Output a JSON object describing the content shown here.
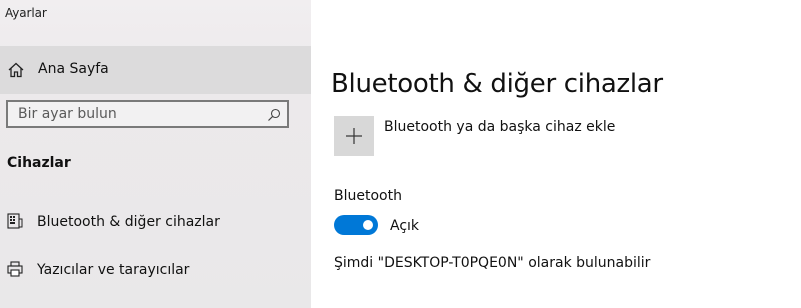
{
  "window": {
    "title": "Ayarlar"
  },
  "sidebar": {
    "home": {
      "label": "Ana Sayfa",
      "icon": "home-icon"
    },
    "search": {
      "placeholder": "Bir ayar bulun",
      "value": "",
      "icon": "search-icon"
    },
    "section_heading": "Cihazlar",
    "items": [
      {
        "label": "Bluetooth & diğer cihazlar",
        "icon": "bluetooth-keyboard-icon"
      },
      {
        "label": "Yazıcılar ve tarayıcılar",
        "icon": "printer-icon"
      }
    ]
  },
  "main": {
    "title": "Bluetooth & diğer cihazlar",
    "add_device": {
      "label": "Bluetooth ya da başka cihaz ekle",
      "icon": "plus-icon"
    },
    "bluetooth": {
      "heading": "Bluetooth",
      "toggle_on": true,
      "state_label": "Açık",
      "accent_color": "#0078d7"
    },
    "discoverable_text": "Şimdi \"DESKTOP-T0PQE0N\" olarak bulunabilir"
  }
}
